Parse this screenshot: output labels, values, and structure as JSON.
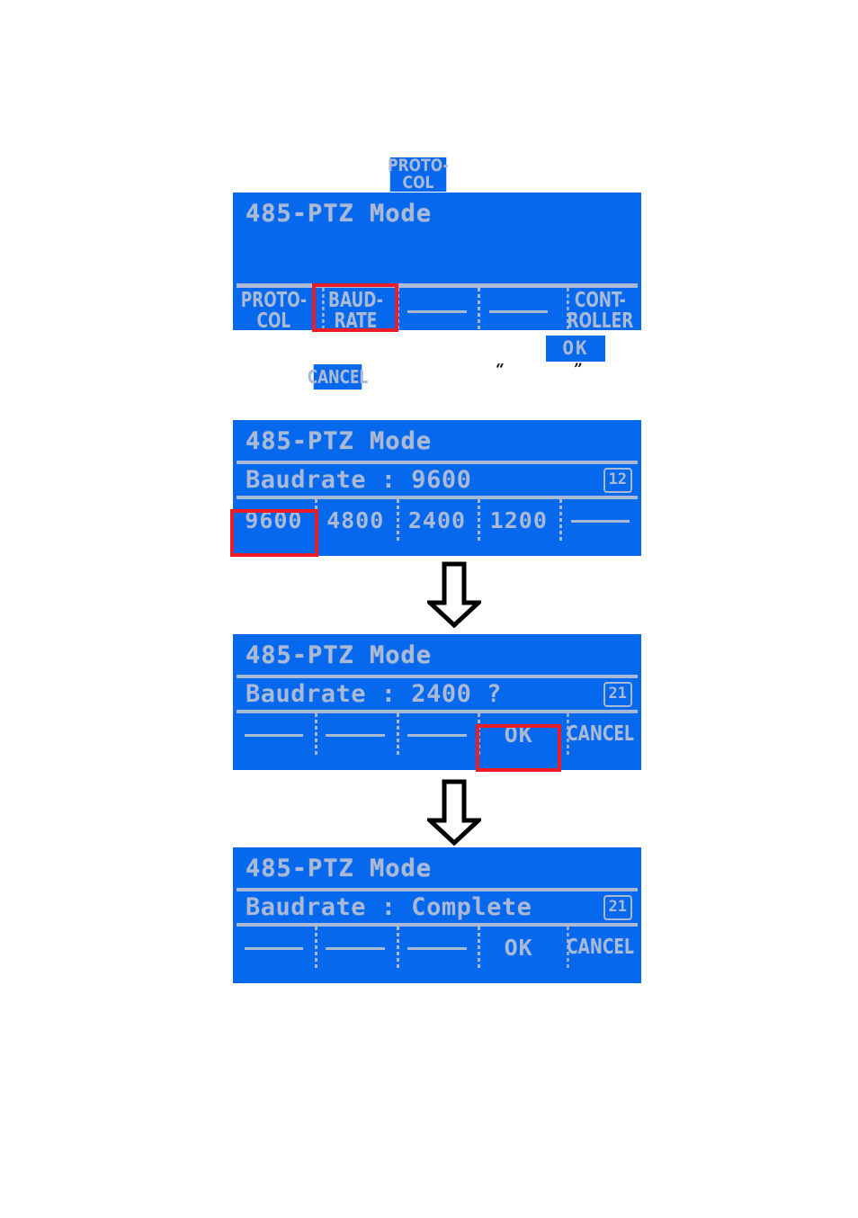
{
  "page": {
    "background_color": "#ffffff",
    "lcd_background_color": "#0668ED",
    "lcd_text_color": "#A9B9D6",
    "highlight_color": "#EE1C25"
  },
  "chips": {
    "protocol": {
      "label": "PROTO-\nCOL",
      "name": "protocol-chip"
    },
    "cancel": {
      "label": "CANCEL",
      "name": "cancel-chip"
    },
    "ok": {
      "label": "OK",
      "name": "ok-chip"
    },
    "quote_open": "“",
    "quote_close": "”"
  },
  "panels": [
    {
      "id": "panel-menu",
      "title": "485-PTZ Mode",
      "keys": [
        {
          "label": "PROTO-\nCOL",
          "type": "text",
          "highlighted": false
        },
        {
          "label": "BAUD-\nRATE",
          "type": "text",
          "highlighted": true
        },
        {
          "label": "",
          "type": "dash",
          "highlighted": false
        },
        {
          "label": "",
          "type": "dash",
          "highlighted": false
        },
        {
          "label": "CONT-\nROLLER",
          "type": "text",
          "highlighted": false
        }
      ]
    },
    {
      "id": "panel-baudrate-select",
      "title": "485-PTZ Mode",
      "value_label": "Baudrate : 9600",
      "badge": "12",
      "keys": [
        {
          "label": "9600",
          "type": "text",
          "highlighted": true
        },
        {
          "label": "4800",
          "type": "text",
          "highlighted": false
        },
        {
          "label": "2400",
          "type": "text",
          "highlighted": false
        },
        {
          "label": "1200",
          "type": "text",
          "highlighted": false
        },
        {
          "label": "",
          "type": "dash",
          "highlighted": false
        }
      ]
    },
    {
      "id": "panel-baudrate-confirm",
      "title": "485-PTZ Mode",
      "value_label": "Baudrate : 2400 ?",
      "badge": "21",
      "keys": [
        {
          "label": "",
          "type": "dash",
          "highlighted": false
        },
        {
          "label": "",
          "type": "dash",
          "highlighted": false
        },
        {
          "label": "",
          "type": "dash",
          "highlighted": false
        },
        {
          "label": "OK",
          "type": "text",
          "highlighted": true
        },
        {
          "label": "CANCEL",
          "type": "text",
          "highlighted": false
        }
      ]
    },
    {
      "id": "panel-baudrate-complete",
      "title": "485-PTZ Mode",
      "value_label": "Baudrate : Complete",
      "badge": "21",
      "keys": [
        {
          "label": "",
          "type": "dash",
          "highlighted": false
        },
        {
          "label": "",
          "type": "dash",
          "highlighted": false
        },
        {
          "label": "",
          "type": "dash",
          "highlighted": false
        },
        {
          "label": "OK",
          "type": "text",
          "highlighted": false
        },
        {
          "label": "CANCEL",
          "type": "text",
          "highlighted": false
        }
      ]
    }
  ],
  "arrows": [
    {
      "name": "flow-arrow-down-1",
      "direction": "down"
    },
    {
      "name": "flow-arrow-down-2",
      "direction": "down"
    }
  ]
}
